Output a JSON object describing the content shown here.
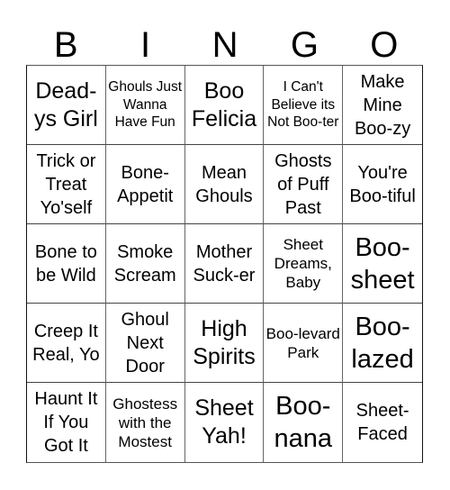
{
  "header": [
    "B",
    "I",
    "N",
    "G",
    "O"
  ],
  "cells": [
    {
      "text": "Dead-ys Girl",
      "size": "l"
    },
    {
      "text": "Ghouls Just Wanna Have Fun",
      "size": "xs"
    },
    {
      "text": "Boo Felicia",
      "size": "l"
    },
    {
      "text": "I Can't Believe its Not Boo-ter",
      "size": "xs"
    },
    {
      "text": "Make Mine Boo-zy",
      "size": "m"
    },
    {
      "text": "Trick or Treat Yo'self",
      "size": "m"
    },
    {
      "text": "Bone-Appetit",
      "size": "m"
    },
    {
      "text": "Mean Ghouls",
      "size": "m"
    },
    {
      "text": "Ghosts of Puff Past",
      "size": "m"
    },
    {
      "text": "You're Boo-tiful",
      "size": "m"
    },
    {
      "text": "Bone to be Wild",
      "size": "m"
    },
    {
      "text": "Smoke Scream",
      "size": "m"
    },
    {
      "text": "Mother Suck-er",
      "size": "m"
    },
    {
      "text": "Sheet Dreams, Baby",
      "size": "s"
    },
    {
      "text": "Boo-sheet",
      "size": "xl"
    },
    {
      "text": "Creep It Real, Yo",
      "size": "m"
    },
    {
      "text": "Ghoul Next Door",
      "size": "m"
    },
    {
      "text": "High Spirits",
      "size": "l"
    },
    {
      "text": "Boo-levard Park",
      "size": "s"
    },
    {
      "text": "Boo-lazed",
      "size": "xl"
    },
    {
      "text": "Haunt It If You Got It",
      "size": "m"
    },
    {
      "text": "Ghostess with the Mostest",
      "size": "s"
    },
    {
      "text": "Sheet Yah!",
      "size": "l"
    },
    {
      "text": "Boo-nana",
      "size": "xl"
    },
    {
      "text": "Sheet-Faced",
      "size": "m"
    }
  ]
}
